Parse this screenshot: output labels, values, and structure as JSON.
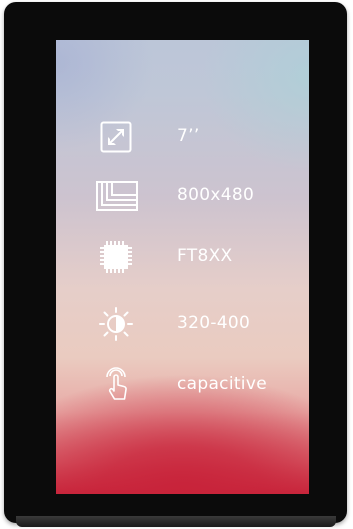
{
  "device": {
    "specs": [
      {
        "icon": "screen-size-icon",
        "label": "7’’"
      },
      {
        "icon": "resolution-icon",
        "label": "800x480"
      },
      {
        "icon": "chip-icon",
        "label": "FT8XX"
      },
      {
        "icon": "brightness-icon",
        "label": "320-400"
      },
      {
        "icon": "touch-icon",
        "label": "capacitive"
      }
    ]
  },
  "colors": {
    "bezel": "#0b0b0b",
    "text": "#ffffff",
    "accent_bottom": "#c8233a"
  }
}
